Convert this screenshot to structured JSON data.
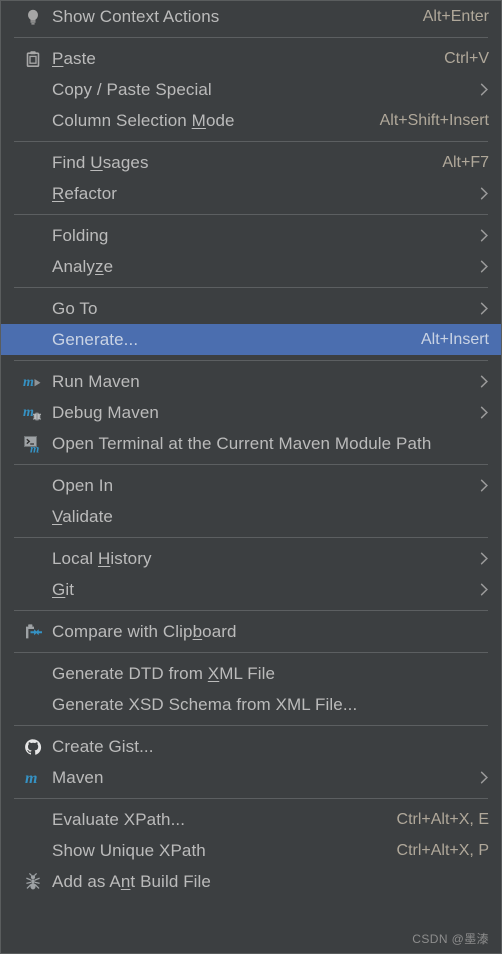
{
  "menu": {
    "background_color": "#3c3f41",
    "text_color": "#bbbbbb",
    "accel_color": "#b0a89a",
    "highlight_color": "#4b6eaf",
    "separator_color": "#5c5f61",
    "maven_blue": "#3592c4",
    "sections": [
      {
        "items": [
          {
            "label_pre": "",
            "mnemonic": "",
            "label_post": "Show Context Actions",
            "accel": "Alt+Enter",
            "icon": "lightbulb-icon",
            "submenu": false
          }
        ]
      },
      {
        "items": [
          {
            "label_pre": "",
            "mnemonic": "P",
            "label_post": "aste",
            "accel": "Ctrl+V",
            "icon": "clipboard-icon",
            "submenu": false
          },
          {
            "label_pre": "Copy / Paste Special",
            "mnemonic": "",
            "label_post": "",
            "accel": "",
            "icon": "",
            "submenu": true
          },
          {
            "label_pre": "Column Selection ",
            "mnemonic": "M",
            "label_post": "ode",
            "accel": "Alt+Shift+Insert",
            "icon": "",
            "submenu": false
          }
        ]
      },
      {
        "items": [
          {
            "label_pre": "Find ",
            "mnemonic": "U",
            "label_post": "sages",
            "accel": "Alt+F7",
            "icon": "",
            "submenu": false
          },
          {
            "label_pre": "",
            "mnemonic": "R",
            "label_post": "efactor",
            "accel": "",
            "icon": "",
            "submenu": true
          }
        ]
      },
      {
        "items": [
          {
            "label_pre": "Folding",
            "mnemonic": "",
            "label_post": "",
            "accel": "",
            "icon": "",
            "submenu": true
          },
          {
            "label_pre": "Analy",
            "mnemonic": "z",
            "label_post": "e",
            "accel": "",
            "icon": "",
            "submenu": true
          }
        ]
      },
      {
        "items": [
          {
            "label_pre": "Go To",
            "mnemonic": "",
            "label_post": "",
            "accel": "",
            "icon": "",
            "submenu": true
          },
          {
            "label_pre": "Generate...",
            "mnemonic": "",
            "label_post": "",
            "accel": "Alt+Insert",
            "icon": "",
            "submenu": false,
            "selected": true
          }
        ]
      },
      {
        "items": [
          {
            "label_pre": "Run Maven",
            "mnemonic": "",
            "label_post": "",
            "accel": "",
            "icon": "maven-run-icon",
            "submenu": true
          },
          {
            "label_pre": "Debug Maven",
            "mnemonic": "",
            "label_post": "",
            "accel": "",
            "icon": "maven-debug-icon",
            "submenu": true
          },
          {
            "label_pre": "Open Terminal at the Current Maven Module Path",
            "mnemonic": "",
            "label_post": "",
            "accel": "",
            "icon": "maven-terminal-icon",
            "submenu": false
          }
        ]
      },
      {
        "items": [
          {
            "label_pre": "Open In",
            "mnemonic": "",
            "label_post": "",
            "accel": "",
            "icon": "",
            "submenu": true
          },
          {
            "label_pre": "",
            "mnemonic": "V",
            "label_post": "alidate",
            "accel": "",
            "icon": "",
            "submenu": false
          }
        ]
      },
      {
        "items": [
          {
            "label_pre": "Local ",
            "mnemonic": "H",
            "label_post": "istory",
            "accel": "",
            "icon": "",
            "submenu": true
          },
          {
            "label_pre": "",
            "mnemonic": "G",
            "label_post": "it",
            "accel": "",
            "icon": "",
            "submenu": true
          }
        ]
      },
      {
        "items": [
          {
            "label_pre": "Compare with Clip",
            "mnemonic": "b",
            "label_post": "oard",
            "accel": "",
            "icon": "compare-clipboard-icon",
            "submenu": false
          }
        ]
      },
      {
        "items": [
          {
            "label_pre": "Generate DTD from ",
            "mnemonic": "X",
            "label_post": "ML File",
            "accel": "",
            "icon": "",
            "submenu": false
          },
          {
            "label_pre": "Generate XSD Schema from XML File...",
            "mnemonic": "",
            "label_post": "",
            "accel": "",
            "icon": "",
            "submenu": false
          }
        ]
      },
      {
        "items": [
          {
            "label_pre": "Create Gist...",
            "mnemonic": "",
            "label_post": "",
            "accel": "",
            "icon": "github-icon",
            "submenu": false
          },
          {
            "label_pre": "Maven",
            "mnemonic": "",
            "label_post": "",
            "accel": "",
            "icon": "maven-icon",
            "submenu": true
          }
        ]
      },
      {
        "items": [
          {
            "label_pre": "Evaluate XPath...",
            "mnemonic": "",
            "label_post": "",
            "accel": "Ctrl+Alt+X, E",
            "icon": "",
            "submenu": false
          },
          {
            "label_pre": "Show Unique XPath",
            "mnemonic": "",
            "label_post": "",
            "accel": "Ctrl+Alt+X, P",
            "icon": "",
            "submenu": false
          },
          {
            "label_pre": "Add as A",
            "mnemonic": "n",
            "label_post": "t Build File",
            "accel": "",
            "icon": "ant-icon",
            "submenu": false
          }
        ]
      }
    ]
  },
  "watermark": {
    "text": "CSDN @墨溙"
  }
}
